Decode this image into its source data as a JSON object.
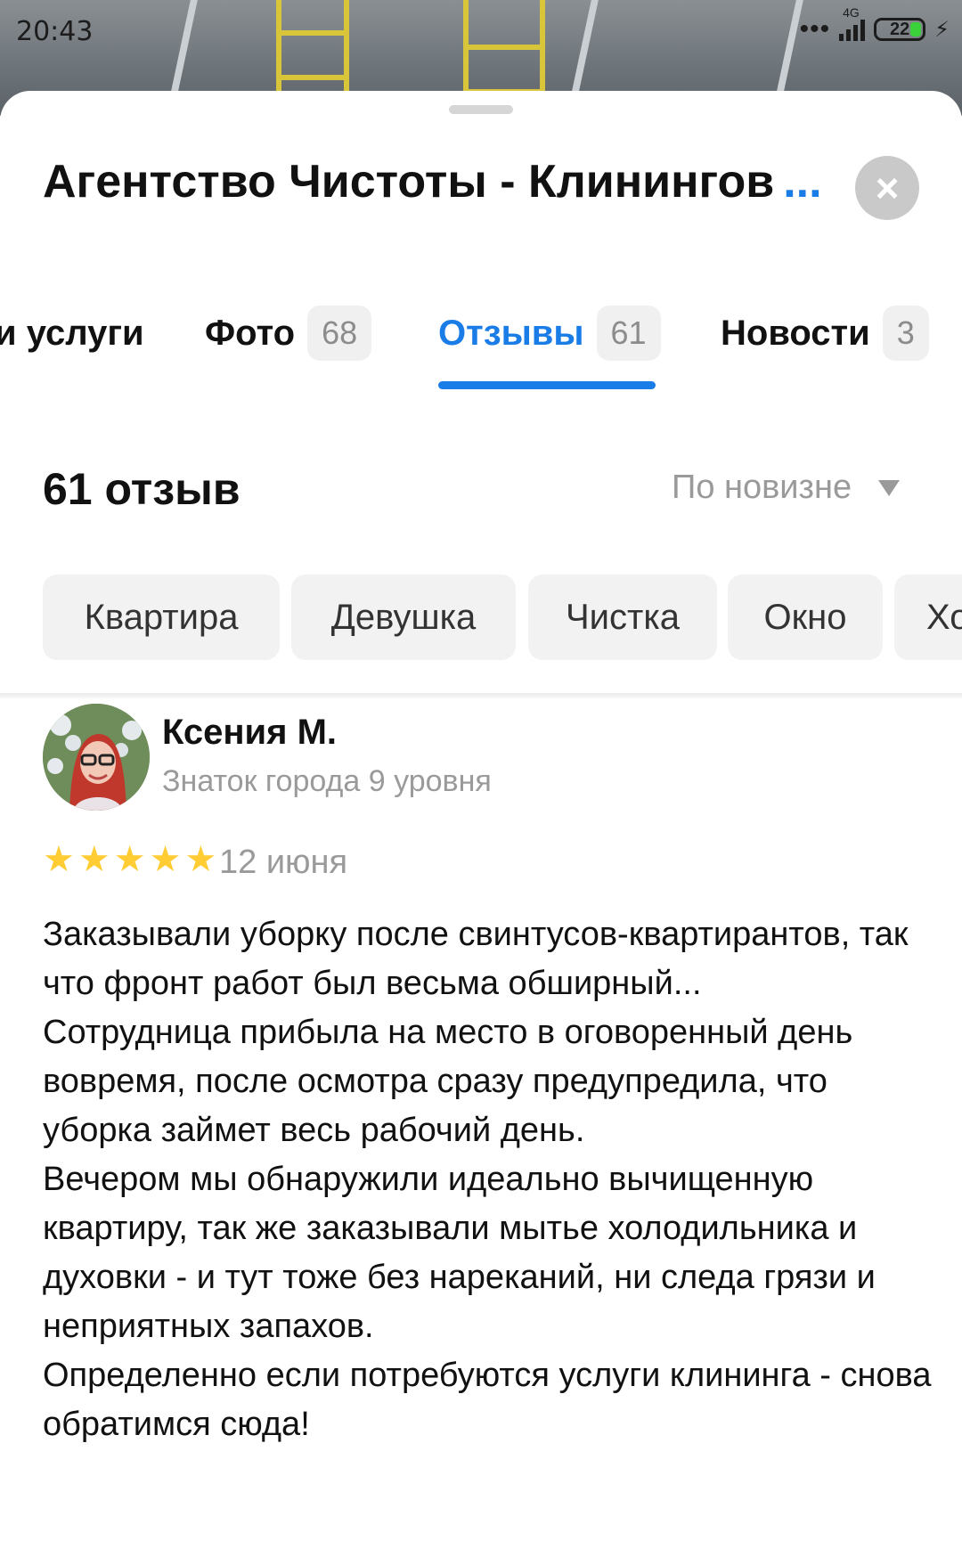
{
  "status_bar": {
    "time": "20:43",
    "network": "4G",
    "battery": "22",
    "icons": [
      "dots-icon",
      "signal-icon",
      "battery-icon",
      "charging-icon"
    ]
  },
  "place": {
    "title": "Агентство Чистоты - Клинингов",
    "title_more": "...",
    "close_icon": "close-icon"
  },
  "tabs": [
    {
      "label": "и услуги",
      "count": ""
    },
    {
      "label": "Фото",
      "count": "68"
    },
    {
      "label": "Отзывы",
      "count": "61",
      "active": true
    },
    {
      "label": "Новости",
      "count": "3"
    }
  ],
  "reviews_header": {
    "count_label": "61 отзыв",
    "sort_label": "По новизне"
  },
  "chips": [
    "Квартира",
    "Девушка",
    "Чистка",
    "Окно",
    "Хо"
  ],
  "review": {
    "author": "Ксения М.",
    "level": "Знаток города 9 уровня",
    "rating": 5,
    "date": "12 июня",
    "paragraphs": [
      "Заказывали уборку после свинтусов-квартирантов, так что фронт работ был весьма обширный...",
      "Сотрудница прибыла на место в оговоренный день вовремя, после осмотра сразу предупредила, что уборка займет весь рабочий день.",
      "Вечером мы обнаружили идеально вычищенную квартиру, так же заказывали мытье холодильника и духовки - и тут тоже без нареканий, ни следа грязи и неприятных запахов.",
      "Определенно если потребуются услуги клининга - снова обратимся сюда!"
    ]
  },
  "colors": {
    "accent": "#1a7ce6",
    "star": "#ffcc33",
    "muted_text": "#9a9a9a",
    "chip_bg": "#f2f2f2"
  }
}
